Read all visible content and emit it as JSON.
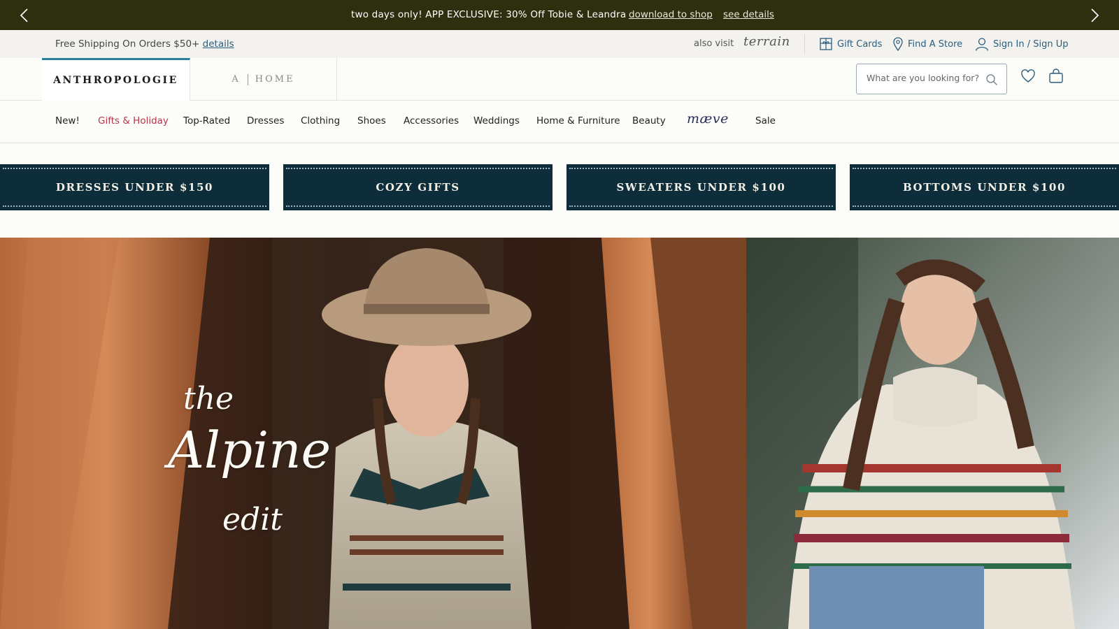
{
  "promo": {
    "message": "two days only! APP EXCLUSIVE: 30% Off Tobie & Leandra",
    "download_link": "download to shop",
    "details_link": "see details"
  },
  "utility": {
    "shipping_text": "Free Shipping On Orders $50+",
    "shipping_link": "details",
    "also_visit": "also visit",
    "terrain": "terrain",
    "gift_cards": "Gift Cards",
    "find_store": "Find A Store",
    "sign_in": "Sign In / Sign Up"
  },
  "brands": {
    "primary": "ANTHROPOLOGIE",
    "home_a": "A",
    "home_label": "HOME"
  },
  "search": {
    "placeholder": "What are you looking for?"
  },
  "nav": {
    "items": [
      "New!",
      "Gifts & Holiday",
      "Top-Rated",
      "Dresses",
      "Clothing",
      "Shoes",
      "Accessories",
      "Weddings",
      "Home & Furniture",
      "Beauty"
    ],
    "maeve": "mæve",
    "sale": "Sale",
    "highlight_color": "#b3374b"
  },
  "banners": [
    "DRESSES UNDER $150",
    "COZY GIFTS",
    "SWEATERS UNDER $100",
    "BOTTOMS UNDER $100"
  ],
  "hero": {
    "script_line1": "the",
    "script_line2": "Alpine",
    "script_line3": "edit"
  },
  "colors": {
    "promo_bg": "#2d2f0f",
    "banner_bg": "#0e2d3a",
    "link": "#2b5d7d",
    "active_tab": "#2b7fa1"
  },
  "icons": [
    "chevron-left-icon",
    "chevron-right-icon",
    "gift-card-icon",
    "location-pin-icon",
    "user-icon",
    "search-icon",
    "heart-icon",
    "bag-icon"
  ]
}
